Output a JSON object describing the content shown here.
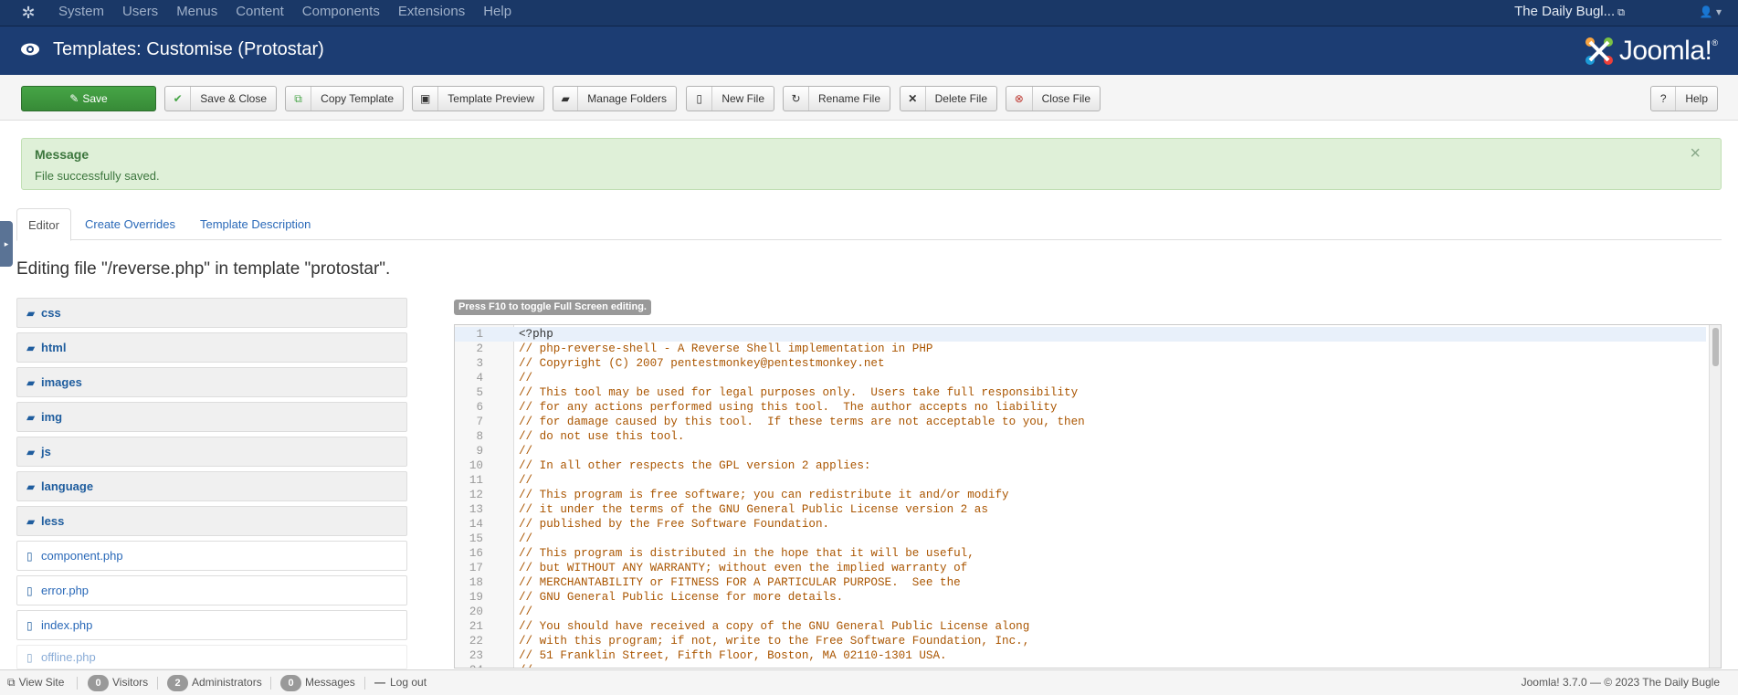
{
  "navbar": {
    "menu": [
      "System",
      "Users",
      "Menus",
      "Content",
      "Components",
      "Extensions",
      "Help"
    ],
    "site_name": "The Daily Bugl..."
  },
  "header": {
    "title": "Templates: Customise (Protostar)",
    "brand": "Joomla!"
  },
  "toolbar": {
    "save": "Save",
    "save_close": "Save & Close",
    "copy_template": "Copy Template",
    "template_preview": "Template Preview",
    "manage_folders": "Manage Folders",
    "new_file": "New File",
    "rename_file": "Rename File",
    "delete_file": "Delete File",
    "close_file": "Close File",
    "help": "Help"
  },
  "message": {
    "heading": "Message",
    "text": "File successfully saved."
  },
  "tabs": [
    "Editor",
    "Create Overrides",
    "Template Description"
  ],
  "editing_title": "Editing file \"/reverse.php\" in template \"protostar\".",
  "tree": {
    "folders": [
      "css",
      "html",
      "images",
      "img",
      "js",
      "language",
      "less"
    ],
    "files": [
      "component.php",
      "error.php",
      "index.php",
      "offline.php"
    ]
  },
  "editor": {
    "hint": "Press F10 to toggle Full Screen editing.",
    "lines": [
      "<?php",
      "// php-reverse-shell - A Reverse Shell implementation in PHP",
      "// Copyright (C) 2007 pentestmonkey@pentestmonkey.net",
      "//",
      "// This tool may be used for legal purposes only.  Users take full responsibility",
      "// for any actions performed using this tool.  The author accepts no liability",
      "// for damage caused by this tool.  If these terms are not acceptable to you, then",
      "// do not use this tool.",
      "//",
      "// In all other respects the GPL version 2 applies:",
      "//",
      "// This program is free software; you can redistribute it and/or modify",
      "// it under the terms of the GNU General Public License version 2 as",
      "// published by the Free Software Foundation.",
      "//",
      "// This program is distributed in the hope that it will be useful,",
      "// but WITHOUT ANY WARRANTY; without even the implied warranty of",
      "// MERCHANTABILITY or FITNESS FOR A PARTICULAR PURPOSE.  See the",
      "// GNU General Public License for more details.",
      "//",
      "// You should have received a copy of the GNU General Public License along",
      "// with this program; if not, write to the Free Software Foundation, Inc.,",
      "// 51 Franklin Street, Fifth Floor, Boston, MA 02110-1301 USA.",
      "//"
    ]
  },
  "statusbar": {
    "view_site": "View Site",
    "visitors_count": "0",
    "visitors_label": "Visitors",
    "admins_count": "2",
    "admins_label": "Administrators",
    "messages_count": "0",
    "messages_label": "Messages",
    "logout": "Log out",
    "version": "Joomla! 3.7.0  —  © 2023 The Daily Bugle"
  },
  "colors": {
    "navbar": "#1a3867",
    "header": "#1c3d73",
    "save_button": "#46a546",
    "alert_bg": "#dff0d8",
    "link": "#2a69b8",
    "code_comment": "#aa5500"
  }
}
